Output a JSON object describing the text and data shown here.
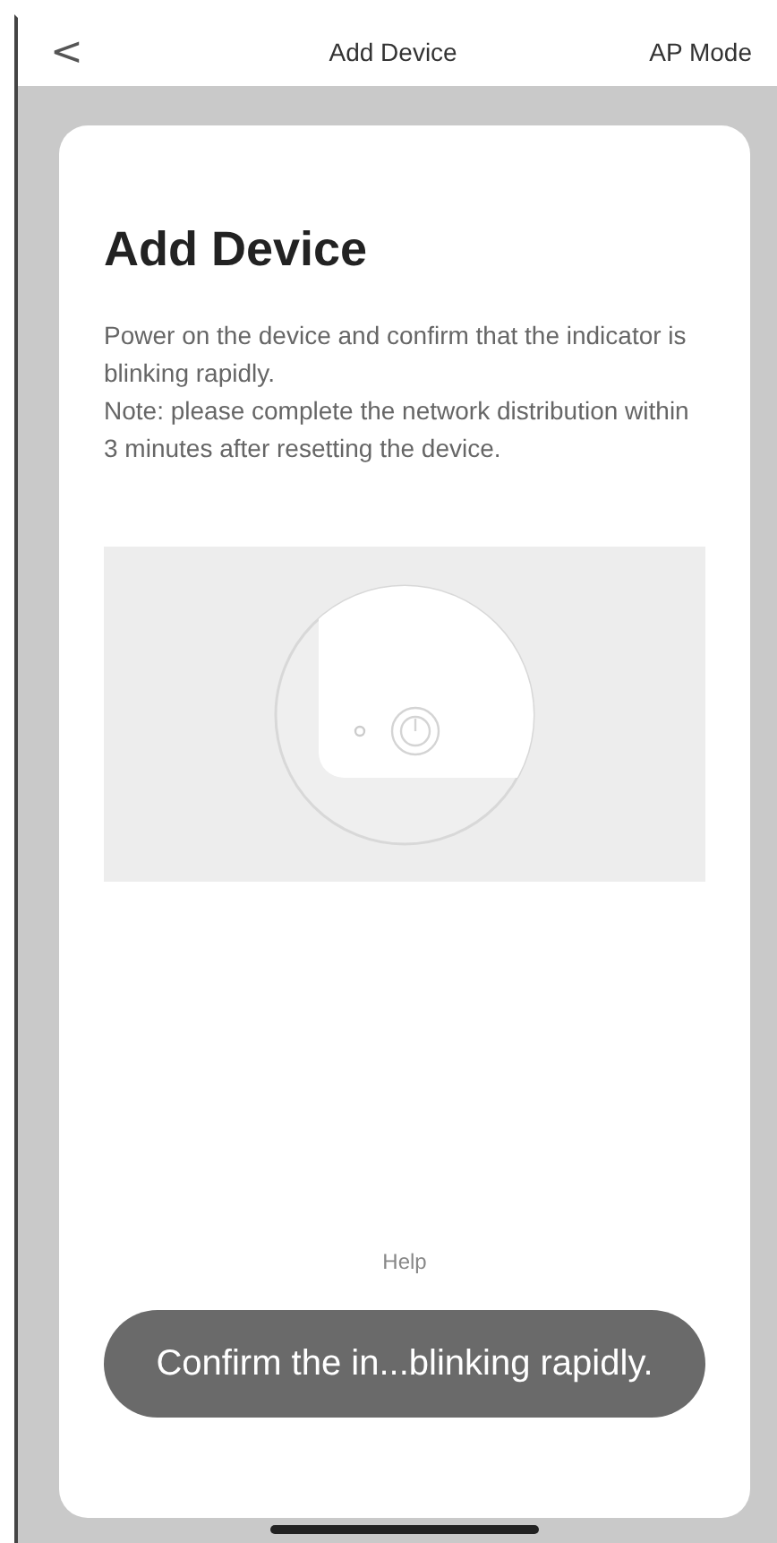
{
  "nav_bar": {
    "back": "<",
    "title": "Add Device",
    "action": "AP Mode"
  },
  "card": {
    "heading": "Add Device",
    "instructions": [
      "Power on the device and confirm that the indicator is blinking rapidly.",
      "Note: please complete the network distribution within 3 minutes after resetting the device."
    ],
    "help_link": "Help"
  },
  "toast": "Confirm the in...blinking rapidly."
}
